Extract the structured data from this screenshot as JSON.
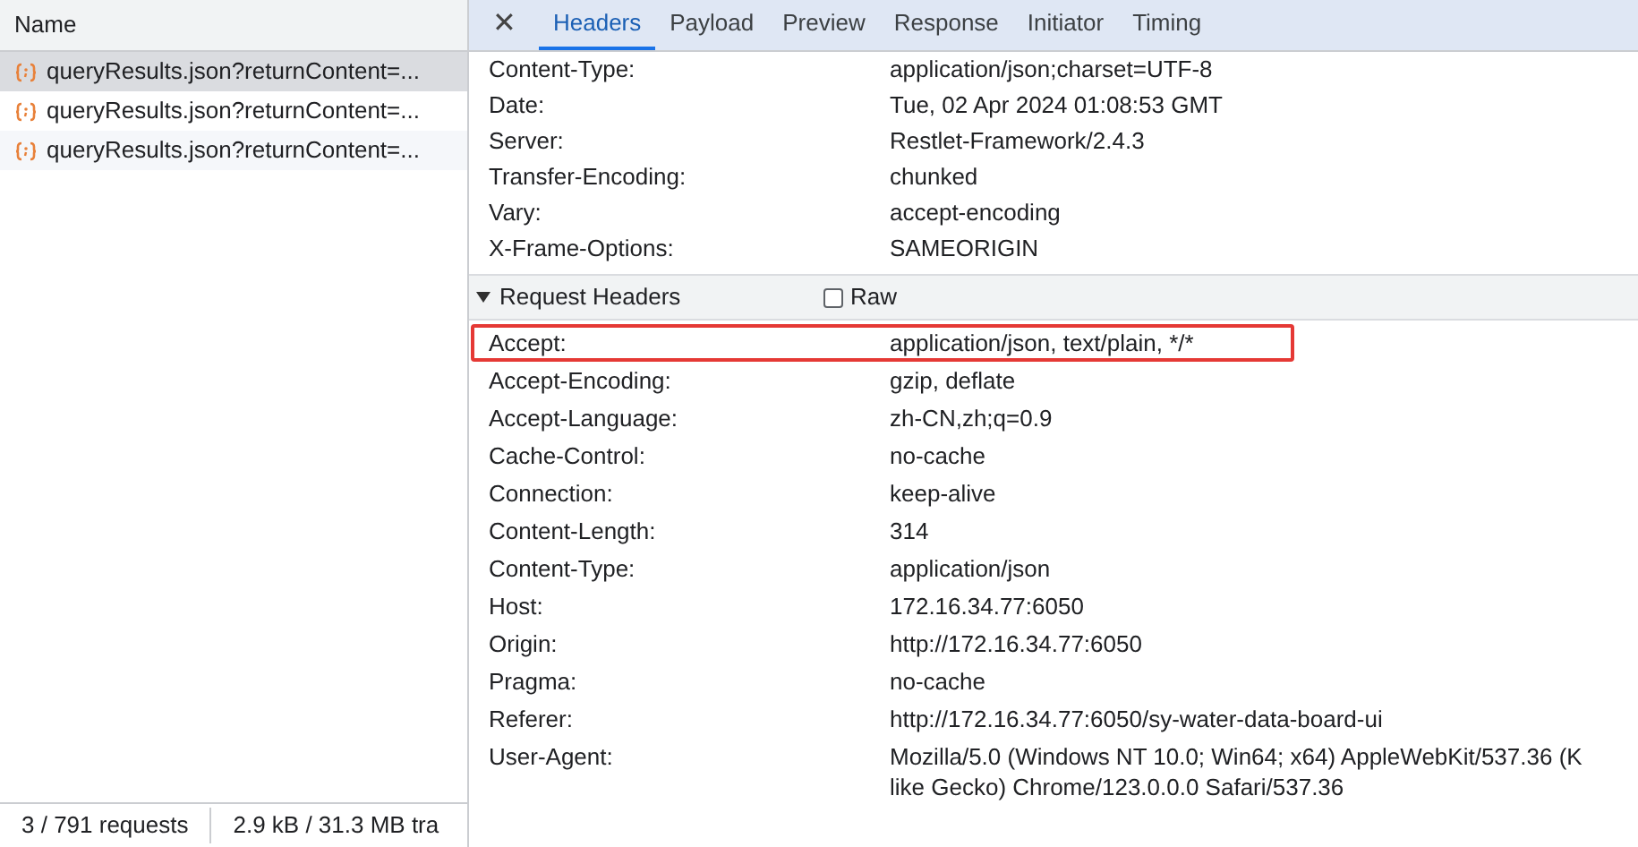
{
  "requests": {
    "column": "Name",
    "rows": [
      {
        "name": "queryResults.json?returnContent=...",
        "selected": true
      },
      {
        "name": "queryResults.json?returnContent=...",
        "selected": false
      },
      {
        "name": "queryResults.json?returnContent=...",
        "selected": false
      }
    ],
    "status": [
      "3 / 791 requests",
      "2.9 kB / 31.3 MB tra"
    ]
  },
  "tabs": [
    {
      "label": "Headers",
      "selected": true
    },
    {
      "label": "Payload",
      "selected": false
    },
    {
      "label": "Preview",
      "selected": false
    },
    {
      "label": "Response",
      "selected": false
    },
    {
      "label": "Initiator",
      "selected": false
    },
    {
      "label": "Timing",
      "selected": false
    }
  ],
  "close_glyph": "✕",
  "response_headers": [
    {
      "name": "Content-Type:",
      "value": "application/json;charset=UTF-8"
    },
    {
      "name": "Date:",
      "value": "Tue, 02 Apr 2024 01:08:53 GMT"
    },
    {
      "name": "Server:",
      "value": "Restlet-Framework/2.4.3"
    },
    {
      "name": "Transfer-Encoding:",
      "value": "chunked"
    },
    {
      "name": "Vary:",
      "value": "accept-encoding"
    },
    {
      "name": "X-Frame-Options:",
      "value": "SAMEORIGIN"
    }
  ],
  "request_section": {
    "title": "Request Headers",
    "expanded": true,
    "raw": {
      "label": "Raw",
      "checked": false
    }
  },
  "request_headers": [
    {
      "name": "Accept:",
      "value": [
        "application/json, text/plain, */*"
      ],
      "highlighted": true
    },
    {
      "name": "Accept-Encoding:",
      "value": [
        "gzip, deflate"
      ],
      "highlighted": false
    },
    {
      "name": "Accept-Language:",
      "value": [
        "zh-CN,zh;q=0.9"
      ],
      "highlighted": false
    },
    {
      "name": "Cache-Control:",
      "value": [
        "no-cache"
      ],
      "highlighted": false
    },
    {
      "name": "Connection:",
      "value": [
        "keep-alive"
      ],
      "highlighted": false
    },
    {
      "name": "Content-Length:",
      "value": [
        "314"
      ],
      "highlighted": false
    },
    {
      "name": "Content-Type:",
      "value": [
        "application/json"
      ],
      "highlighted": false
    },
    {
      "name": "Host:",
      "value": [
        "172.16.34.77:6050"
      ],
      "highlighted": false
    },
    {
      "name": "Origin:",
      "value": [
        "http://172.16.34.77:6050"
      ],
      "highlighted": false
    },
    {
      "name": "Pragma:",
      "value": [
        "no-cache"
      ],
      "highlighted": false
    },
    {
      "name": "Referer:",
      "value": [
        "http://172.16.34.77:6050/sy-water-data-board-ui"
      ],
      "highlighted": false
    },
    {
      "name": "User-Agent:",
      "value": [
        "Mozilla/5.0 (Windows NT 10.0; Win64; x64) AppleWebKit/537.36 (K",
        "like Gecko) Chrome/123.0.0.0 Safari/537.36"
      ],
      "highlighted": false
    }
  ]
}
